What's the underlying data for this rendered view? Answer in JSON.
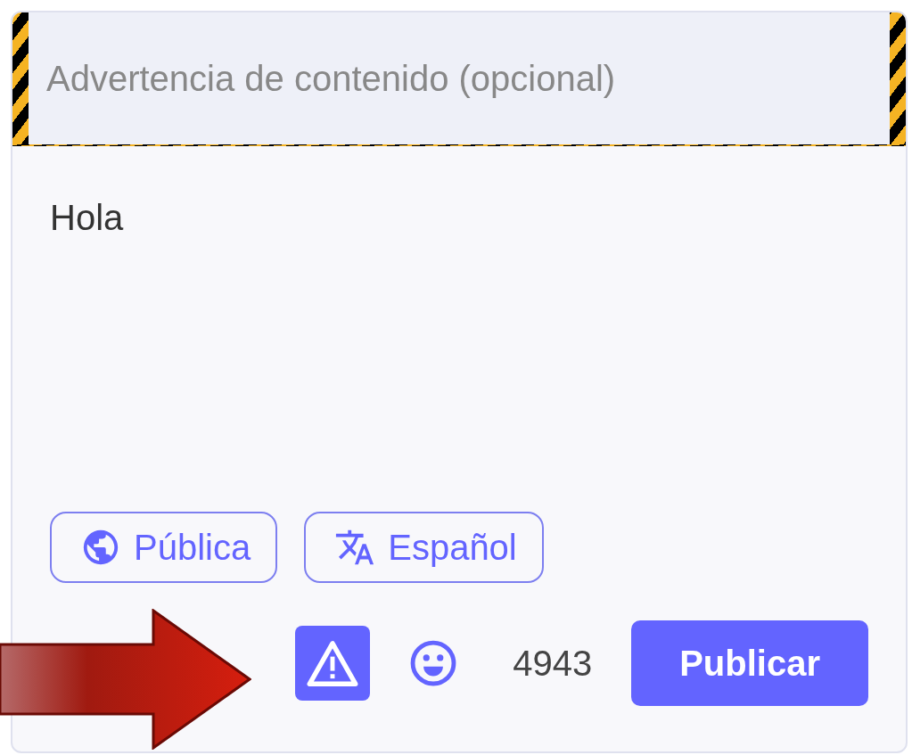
{
  "content_warning": {
    "placeholder": "Advertencia de contenido (opcional)"
  },
  "status_text": {
    "value": "Hola"
  },
  "options": [
    {
      "kind": "visibility",
      "label": "Pública"
    },
    {
      "kind": "language",
      "label": "Español"
    }
  ],
  "cw_toggle": {
    "selected": true
  },
  "char_count": "4943",
  "publish_button": {
    "label": "Publicar"
  }
}
